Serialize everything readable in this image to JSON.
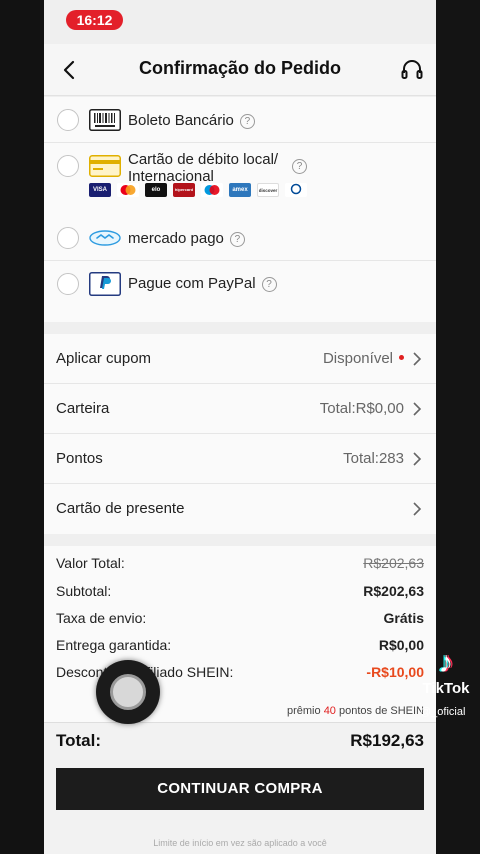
{
  "status": {
    "time": "16:12"
  },
  "header": {
    "title": "Confirmação do Pedido",
    "back_icon": "chevron-left-icon",
    "support_icon": "headset-icon"
  },
  "payment_methods": [
    {
      "label": "Boleto Bancário",
      "icon": "boleto-barcode-icon"
    },
    {
      "label": "Cartão de débito local/ Internacional",
      "icon": "card-icon",
      "brands": [
        "VISA",
        "mastercard",
        "elo",
        "hipercard",
        "maestro",
        "amex",
        "discover",
        "diners"
      ]
    },
    {
      "label": "mercado pago",
      "icon": "mercado-pago-icon"
    },
    {
      "label": "Pague com PayPal",
      "icon": "paypal-icon"
    }
  ],
  "options": [
    {
      "label": "Aplicar cupom",
      "value": "Disponível",
      "dot": true
    },
    {
      "label": "Carteira",
      "value": "Total:R$0,00"
    },
    {
      "label": "Pontos",
      "value": "Total:283"
    },
    {
      "label": "Cartão de presente",
      "value": ""
    }
  ],
  "summary": {
    "rows": [
      {
        "label": "Valor Total:",
        "value": "R$202,63"
      },
      {
        "label": "Subtotal:",
        "value": "R$202,63"
      },
      {
        "label": "Taxa de envio:",
        "value": "Grátis"
      },
      {
        "label": "Entrega garantida:",
        "value": "R$0,00"
      },
      {
        "label": "Desconto de afiliado SHEIN:",
        "value": "-R$10,00"
      }
    ],
    "points_note_prefix": "prêmio",
    "points_note_number": "40",
    "points_note_suffix": "pontos de SHEIN"
  },
  "footer": {
    "total_label": "Total:",
    "total_value": "R$192,63",
    "cta_label": "CONTINUAR COMPRA",
    "footnote": "Limite de início em vez são aplicado a você"
  },
  "overlay": {
    "tiktok_word": "TikTok",
    "tiktok_user": "@_oficial"
  },
  "colors": {
    "accent_red": "#e02020",
    "status_pill": "#e3202a",
    "cta_bg": "#1c1c1c"
  }
}
